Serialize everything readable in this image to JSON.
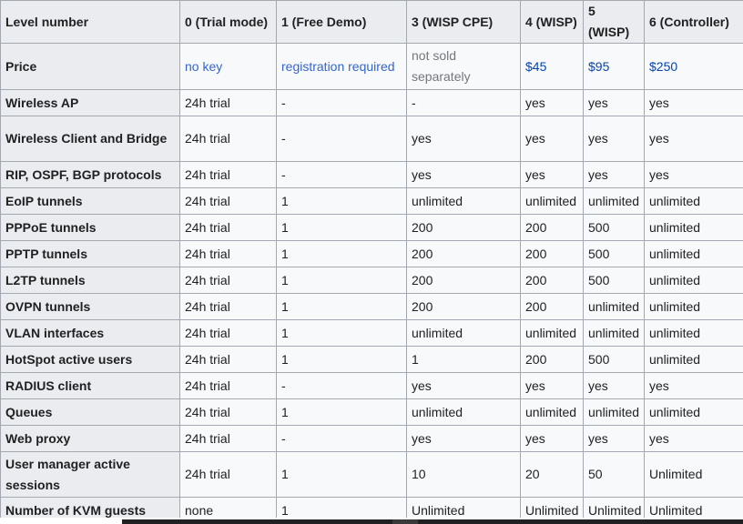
{
  "table": {
    "headers": [
      "Level number",
      "0 (Trial mode)",
      "1 (Free Demo)",
      "3 (WISP CPE)",
      "4 (WISP)",
      "5 (WISP)",
      "6 (Controller)"
    ],
    "price": {
      "label": "Price",
      "values": [
        "no key",
        "registration required",
        "not sold separately",
        "$45",
        "$95",
        "$250"
      ]
    },
    "rows": [
      {
        "label": "Wireless AP",
        "values": [
          "24h trial",
          "-",
          "-",
          "yes",
          "yes",
          "yes"
        ]
      },
      {
        "label": "Wireless Client and Bridge",
        "values": [
          "24h trial",
          "-",
          "yes",
          "yes",
          "yes",
          "yes"
        ]
      },
      {
        "label": "RIP, OSPF, BGP protocols",
        "values": [
          "24h trial",
          "-",
          "yes",
          "yes",
          "yes",
          "yes"
        ]
      },
      {
        "label": "EoIP tunnels",
        "values": [
          "24h trial",
          "1",
          "unlimited",
          "unlimited",
          "unlimited",
          "unlimited"
        ]
      },
      {
        "label": "PPPoE tunnels",
        "values": [
          "24h trial",
          "1",
          "200",
          "200",
          "500",
          "unlimited"
        ]
      },
      {
        "label": "PPTP tunnels",
        "values": [
          "24h trial",
          "1",
          "200",
          "200",
          "500",
          "unlimited"
        ]
      },
      {
        "label": "L2TP tunnels",
        "values": [
          "24h trial",
          "1",
          "200",
          "200",
          "500",
          "unlimited"
        ]
      },
      {
        "label": "OVPN tunnels",
        "values": [
          "24h trial",
          "1",
          "200",
          "200",
          "unlimited",
          "unlimited"
        ]
      },
      {
        "label": "VLAN interfaces",
        "values": [
          "24h trial",
          "1",
          "unlimited",
          "unlimited",
          "unlimited",
          "unlimited"
        ]
      },
      {
        "label": "HotSpot active users",
        "values": [
          "24h trial",
          "1",
          "1",
          "200",
          "500",
          "unlimited"
        ]
      },
      {
        "label": "RADIUS client",
        "values": [
          "24h trial",
          "-",
          "yes",
          "yes",
          "yes",
          "yes"
        ]
      },
      {
        "label": "Queues",
        "values": [
          "24h trial",
          "1",
          "unlimited",
          "unlimited",
          "unlimited",
          "unlimited"
        ]
      },
      {
        "label": "Web proxy",
        "values": [
          "24h trial",
          "-",
          "yes",
          "yes",
          "yes",
          "yes"
        ]
      },
      {
        "label": "User manager active sessions",
        "values": [
          "24h trial",
          "1",
          "10",
          "20",
          "50",
          "Unlimited"
        ]
      },
      {
        "label": "Number of KVM guests",
        "values": [
          "none",
          "1",
          "Unlimited",
          "Unlimited",
          "Unlimited",
          "Unlimited"
        ]
      }
    ]
  },
  "colors": {
    "header_bg": "#eaecf0",
    "cell_bg": "#f8f9fa",
    "border": "#a2a9b1",
    "link": "#3366cc",
    "price_link": "#0645ad",
    "muted": "#72777d"
  }
}
